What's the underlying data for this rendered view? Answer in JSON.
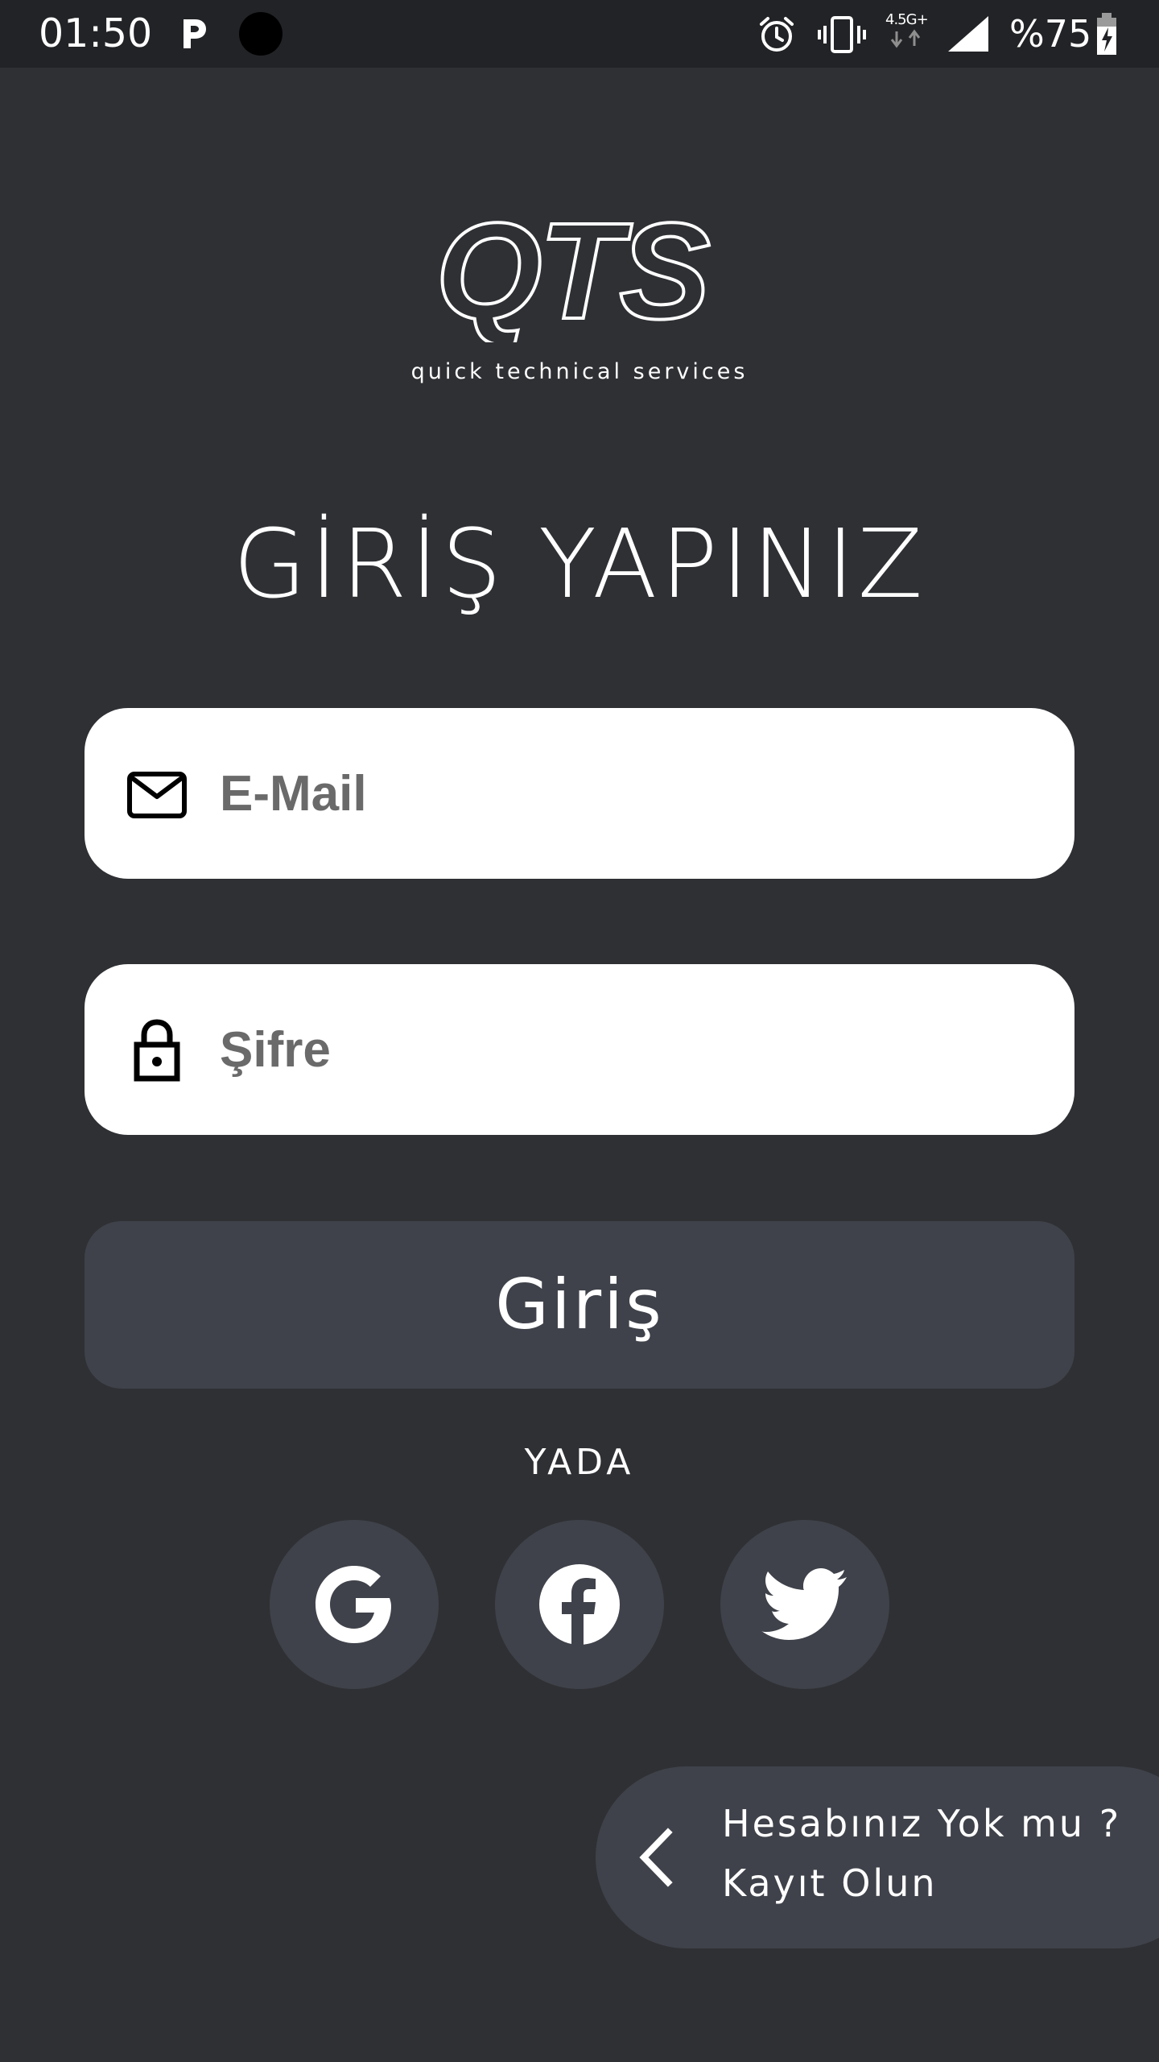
{
  "status_bar": {
    "time": "01:50",
    "network": "4.5G+",
    "battery": "%75",
    "icons": [
      "p-notification-icon",
      "dot-notification-icon",
      "alarm-icon",
      "vibrate-icon",
      "network-4g-icon",
      "signal-icon",
      "battery-charging-icon"
    ]
  },
  "logo": {
    "wordmark": "QTS",
    "tagline": "quick technical services"
  },
  "title": "GİRİŞ YAPINIZ",
  "form": {
    "email": {
      "placeholder": "E-Mail",
      "value": "",
      "icon": "mail-icon"
    },
    "password": {
      "placeholder": "Şifre",
      "value": "",
      "icon": "lock-icon"
    }
  },
  "login_button": "Giriş",
  "or_label": "YADA",
  "social": [
    {
      "name": "google",
      "icon": "google-icon"
    },
    {
      "name": "facebook",
      "icon": "facebook-icon"
    },
    {
      "name": "twitter",
      "icon": "twitter-icon"
    }
  ],
  "register": {
    "line1": "Hesabınız Yok mu ?",
    "line2": "Kayıt Olun",
    "icon": "chevron-left-icon"
  },
  "colors": {
    "background": "#2f3034",
    "status_bar": "#222326",
    "button": "#3f424a",
    "field": "#ffffff",
    "placeholder": "#6a6a6a"
  }
}
